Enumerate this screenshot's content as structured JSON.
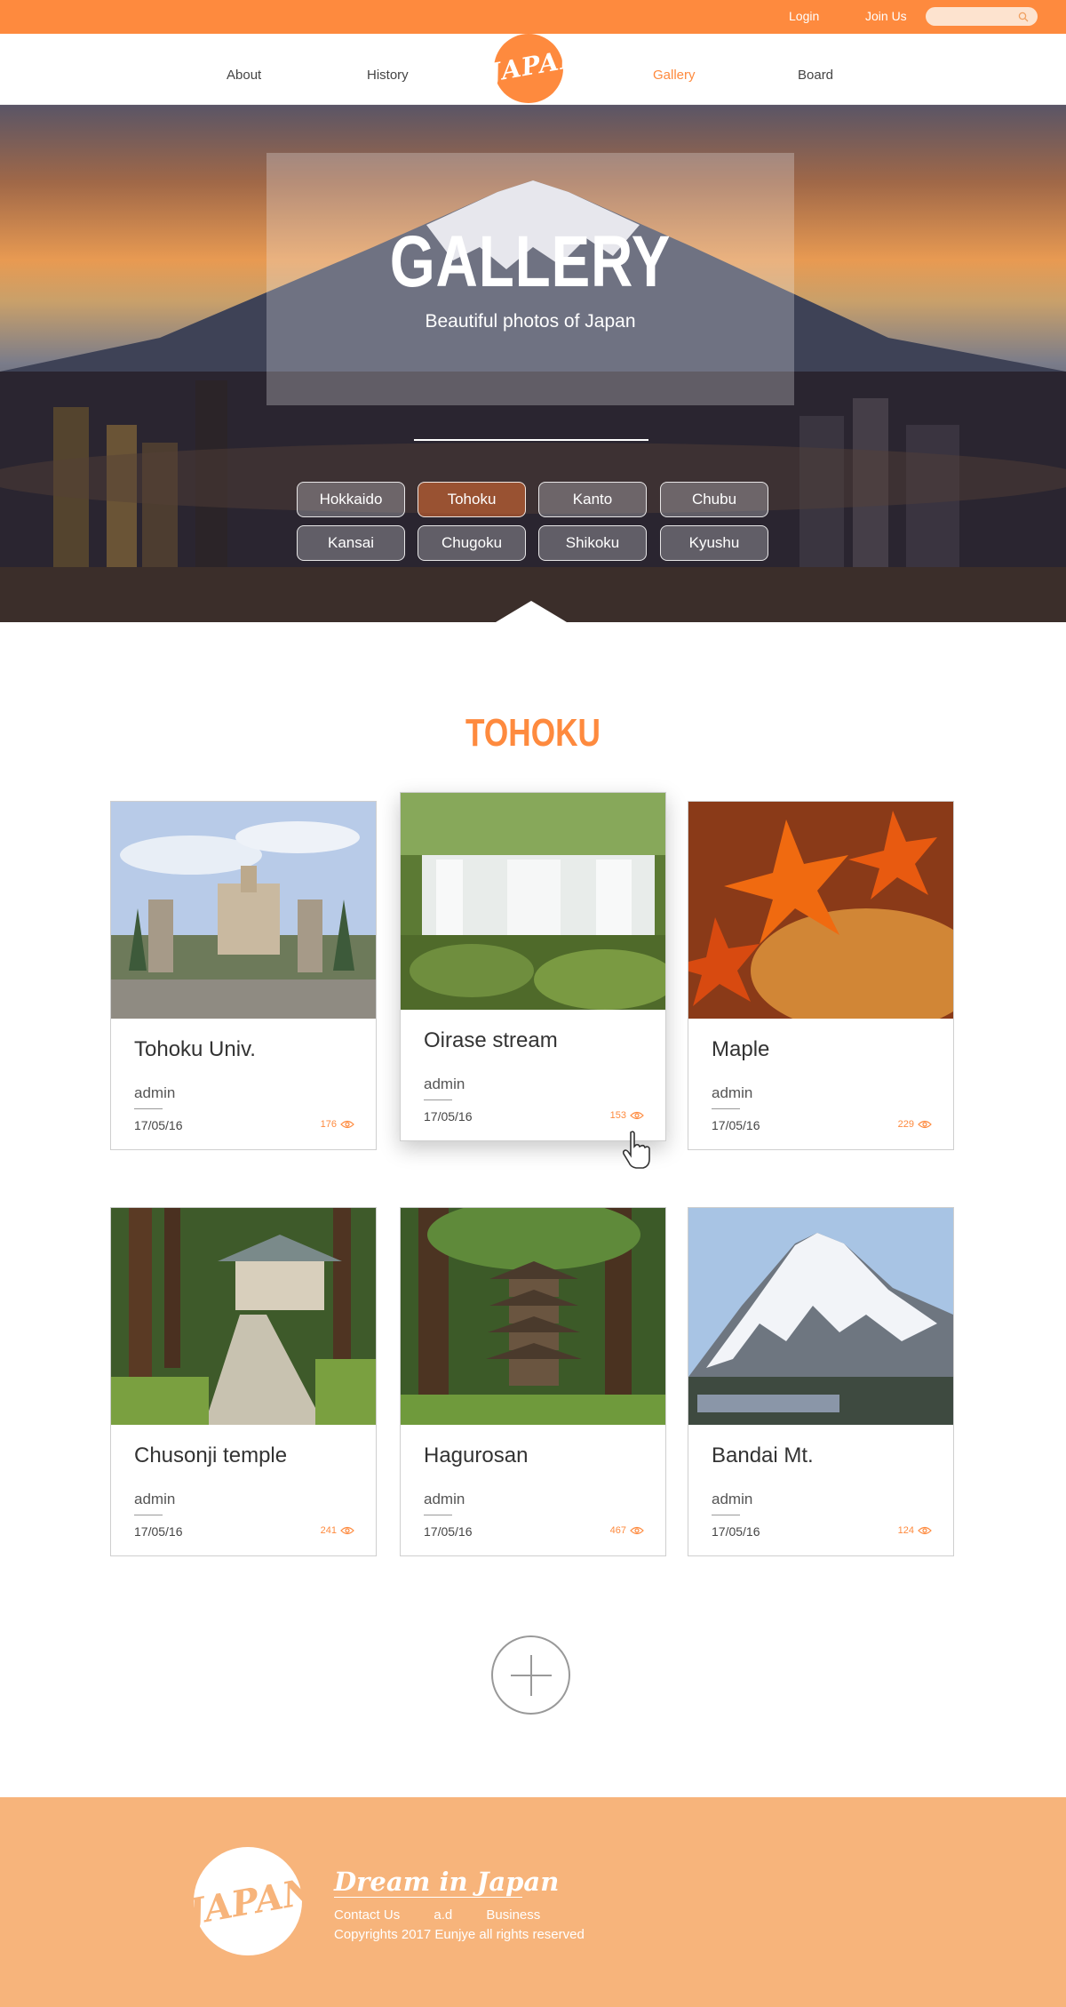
{
  "topbar": {
    "login": "Login",
    "join": "Join Us",
    "search_placeholder": ""
  },
  "nav": {
    "about": "About",
    "history": "History",
    "logo": "JAPAN",
    "gallery": "Gallery",
    "board": "Board"
  },
  "hero": {
    "title": "GALLERY",
    "subtitle": "Beautiful photos of Japan",
    "regions": [
      "Hokkaido",
      "Tohoku",
      "Kanto",
      "Chubu",
      "Kansai",
      "Chugoku",
      "Shikoku",
      "Kyushu"
    ],
    "active_region": "Tohoku"
  },
  "section": {
    "title": "TOHOKU"
  },
  "cards": [
    {
      "name": "Tohoku Univ.",
      "author": "admin",
      "date": "17/05/16",
      "views": "176"
    },
    {
      "name": "Oirase stream",
      "author": "admin",
      "date": "17/05/16",
      "views": "153"
    },
    {
      "name": "Maple",
      "author": "admin",
      "date": "17/05/16",
      "views": "229"
    },
    {
      "name": "Chusonji temple",
      "author": "admin",
      "date": "17/05/16",
      "views": "241"
    },
    {
      "name": "Hagurosan",
      "author": "admin",
      "date": "17/05/16",
      "views": "467"
    },
    {
      "name": "Bandai Mt.",
      "author": "admin",
      "date": "17/05/16",
      "views": "124"
    }
  ],
  "footer": {
    "logo": "JAPAN",
    "slogan": "Dream in Japan",
    "links": [
      "Contact Us",
      "a.d",
      "Business"
    ],
    "copyright": "Copyrights 2017 Eunjye all rights reserved"
  },
  "colors": {
    "accent": "#fe8a3e",
    "footer": "#f7b47b"
  }
}
